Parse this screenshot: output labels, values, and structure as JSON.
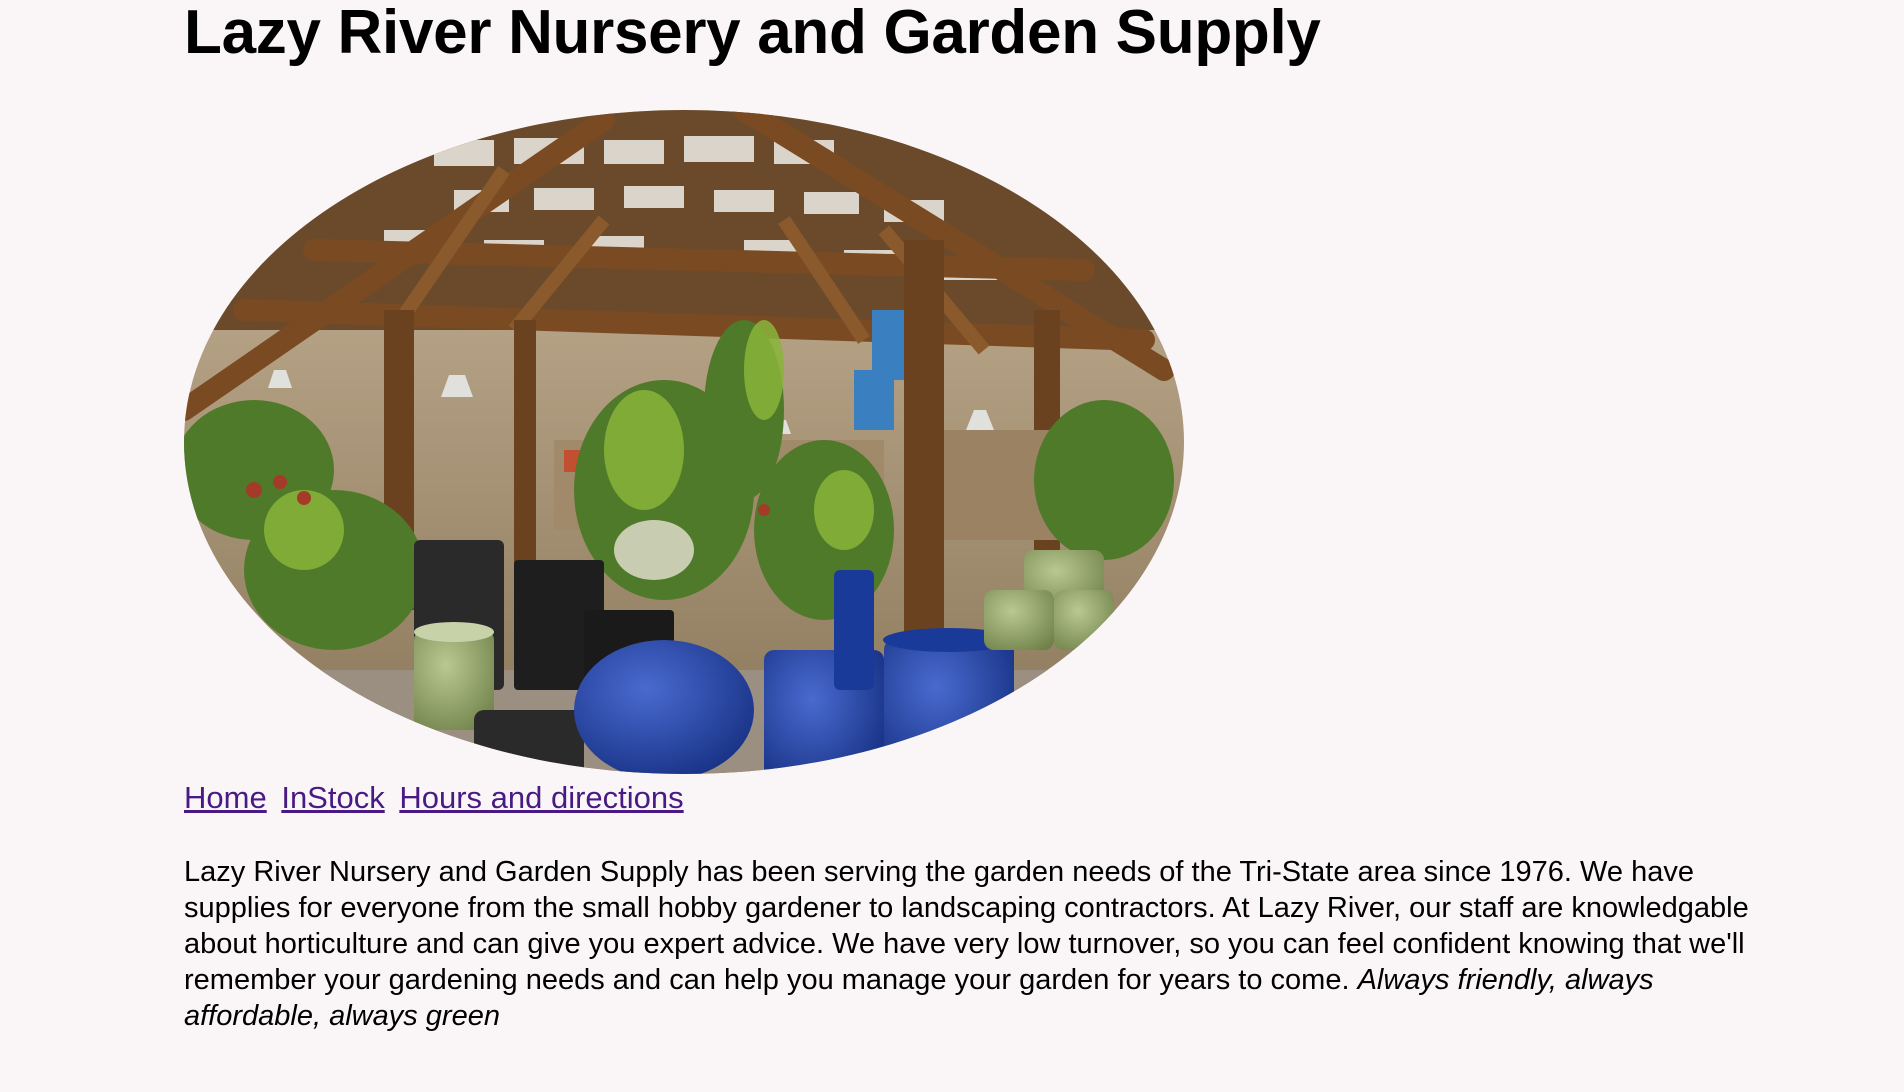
{
  "page": {
    "title": "Lazy River Nursery and Garden Supply",
    "background": "#faf6f8",
    "link_color": "#4a1a84"
  },
  "hero": {
    "description": "greenhouse-interior-photo"
  },
  "nav": {
    "items": [
      {
        "label": "Home"
      },
      {
        "label": "InStock"
      },
      {
        "label": "Hours and directions"
      }
    ]
  },
  "about": {
    "body": "Lazy River Nursery and Garden Supply has been serving the garden needs of the Tri-State area since 1976. We have supplies for everyone from the small hobby gardener to landscaping contractors. At Lazy River, our staff are knowledgable about horticulture and can give you expert advice. We have very low turnover, so you can feel confident knowing that we'll remember your gardening needs and can help you manage your garden for years to come.",
    "tagline": "Always friendly, always affordable, always green"
  }
}
